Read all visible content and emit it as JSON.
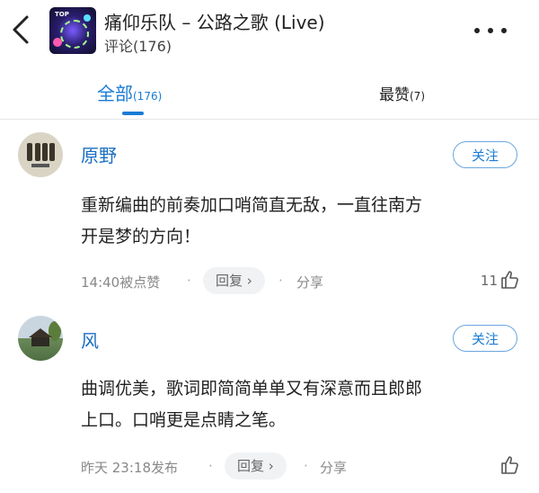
{
  "header": {
    "title": "痛仰乐队 – 公路之歌 (Live)",
    "subtitle": "评论(176)",
    "cover_badge": "TOP"
  },
  "tabs": [
    {
      "label": "全部",
      "count": "(176)",
      "active": true
    },
    {
      "label": "最赞",
      "count": "(7)",
      "active": false
    }
  ],
  "colors": {
    "accent": "#1a7bd6",
    "name": "#1a6fc2"
  },
  "comments": [
    {
      "name": "原野",
      "follow_label": "关注",
      "line1": "重新编曲的前奏加口哨简直无敌，一直往南方",
      "line2": "开是梦的方向！",
      "time": "14:40被点赞",
      "reply_label": "回复 ›",
      "share_label": "分享",
      "likes": "11"
    },
    {
      "name": "风",
      "follow_label": "关注",
      "line1": "曲调优美，歌词即简简单单又有深意而且郎郎",
      "line2": "上口。口哨更是点睛之笔。",
      "time": "昨天 23:18发布",
      "reply_label": "回复 ›",
      "share_label": "分享",
      "likes": ""
    }
  ],
  "icons": {
    "back": "chevron-left-icon",
    "more": "more-dots-icon",
    "like": "thumbs-up-icon"
  }
}
